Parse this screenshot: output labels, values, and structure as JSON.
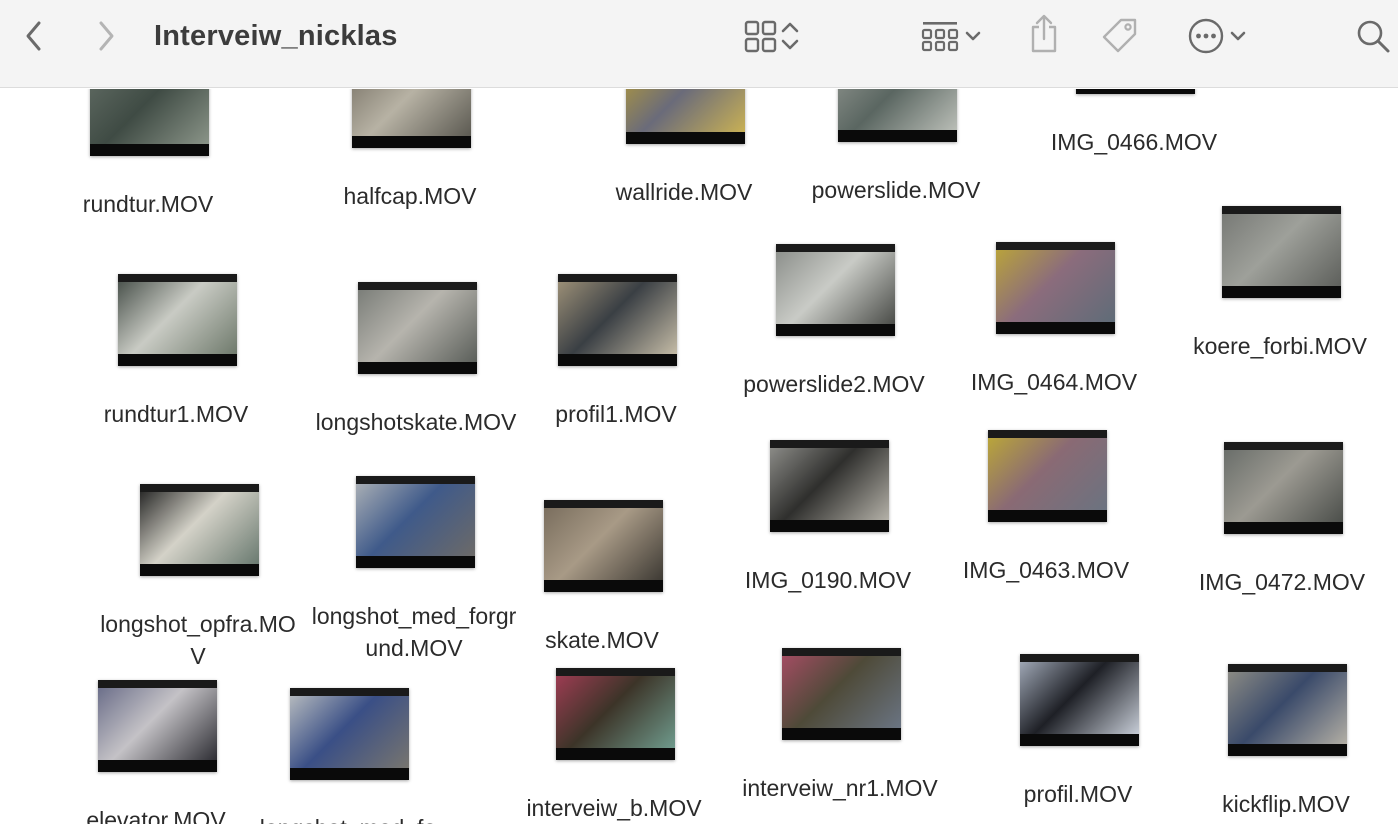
{
  "window": {
    "title": "Interveiw_nicklas"
  },
  "toolbar": {
    "back_icon": "chevron-left-icon",
    "forward_icon": "chevron-right-icon",
    "view_icon": "grid-view-icon",
    "group_icon": "group-grid-icon",
    "share_icon": "share-icon",
    "tag_icon": "tag-icon",
    "more_icon": "ellipsis-circle-icon",
    "search_icon": "search-icon"
  },
  "files": [
    {
      "name": "rundtur.MOV",
      "colors": [
        "#5f6a62",
        "#3f4b44",
        "#8a9488"
      ]
    },
    {
      "name": "halfcap.MOV",
      "colors": [
        "#7a7468",
        "#b7b2a4",
        "#5c5a52"
      ]
    },
    {
      "name": "wallride.MOV",
      "colors": [
        "#b29a3a",
        "#6a6b7a",
        "#c8b055"
      ]
    },
    {
      "name": "powerslide.MOV",
      "colors": [
        "#8f948e",
        "#5a6661",
        "#b9bdb6"
      ]
    },
    {
      "name": "IMG_0466.MOV",
      "colors": [
        "#1a1a1a",
        "#1a1a1a",
        "#1a1a1a"
      ]
    },
    {
      "name": "rundtur1.MOV",
      "colors": [
        "#4c544e",
        "#c9cbc4",
        "#6f7a6c"
      ]
    },
    {
      "name": "longshotskate.MOV",
      "colors": [
        "#7b7e79",
        "#b6b4ad",
        "#5b5f5a"
      ]
    },
    {
      "name": "profil1.MOV",
      "colors": [
        "#9a8e76",
        "#3a3f44",
        "#c4bba6"
      ]
    },
    {
      "name": "powerslide2.MOV",
      "colors": [
        "#8d908c",
        "#c9cbc6",
        "#4a4c48"
      ]
    },
    {
      "name": "IMG_0464.MOV",
      "colors": [
        "#b8a23c",
        "#8b6c7c",
        "#5f6c78"
      ]
    },
    {
      "name": "koere_forbi.MOV",
      "colors": [
        "#787a76",
        "#9ea09a",
        "#5e605c"
      ]
    },
    {
      "name": "longshot_opfra.MOV",
      "colors": [
        "#2b2b2a",
        "#d4d2c8",
        "#6a7a70"
      ]
    },
    {
      "name": "longshot_med_forgrund.MOV",
      "colors": [
        "#a7adb4",
        "#3f5a8a",
        "#6c6a68"
      ]
    },
    {
      "name": "skate.MOV",
      "colors": [
        "#7a6e5e",
        "#a89a86",
        "#3e3a34"
      ]
    },
    {
      "name": "IMG_0190.MOV",
      "colors": [
        "#8a8a86",
        "#2f2f2d",
        "#b4b1a8"
      ]
    },
    {
      "name": "IMG_0463.MOV",
      "colors": [
        "#b9a53a",
        "#8a6a74",
        "#6b7380"
      ]
    },
    {
      "name": "IMG_0472.MOV",
      "colors": [
        "#6a6e6a",
        "#9c9a92",
        "#4c4f4b"
      ]
    },
    {
      "name": "elevator.MOV",
      "colors": [
        "#6c6f8a",
        "#c4c2c6",
        "#2e2e34"
      ]
    },
    {
      "name": "longshot_med_fo",
      "colors": [
        "#b3b8bd",
        "#3a4f86",
        "#77756f"
      ]
    },
    {
      "name": "interveiw_b.MOV",
      "colors": [
        "#9c3c52",
        "#3c3428",
        "#6f9a8c"
      ]
    },
    {
      "name": "interveiw_nr1.MOV",
      "colors": [
        "#a24c62",
        "#4e4a38",
        "#6a7482"
      ]
    },
    {
      "name": "profil.MOV",
      "colors": [
        "#9ea6b4",
        "#1e2026",
        "#c6ccd6"
      ]
    },
    {
      "name": "kickflip.MOV",
      "colors": [
        "#8a8a84",
        "#3a4a6a",
        "#b2aea4"
      ]
    }
  ]
}
